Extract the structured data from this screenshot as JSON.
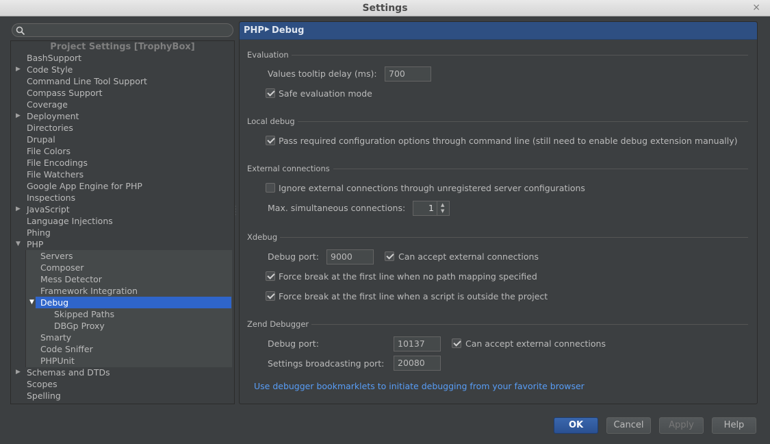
{
  "window": {
    "title": "Settings",
    "close_glyph": "×"
  },
  "search": {
    "placeholder": ""
  },
  "tree": {
    "header": "Project Settings [TrophyBox]",
    "items": [
      {
        "label": "BashSupport",
        "level": 0,
        "expander": ""
      },
      {
        "label": "Code Style",
        "level": 0,
        "expander": "▶"
      },
      {
        "label": "Command Line Tool Support",
        "level": 0,
        "expander": ""
      },
      {
        "label": "Compass Support",
        "level": 0,
        "expander": ""
      },
      {
        "label": "Coverage",
        "level": 0,
        "expander": ""
      },
      {
        "label": "Deployment",
        "level": 0,
        "expander": "▶"
      },
      {
        "label": "Directories",
        "level": 0,
        "expander": ""
      },
      {
        "label": "Drupal",
        "level": 0,
        "expander": ""
      },
      {
        "label": "File Colors",
        "level": 0,
        "expander": ""
      },
      {
        "label": "File Encodings",
        "level": 0,
        "expander": ""
      },
      {
        "label": "File Watchers",
        "level": 0,
        "expander": ""
      },
      {
        "label": "Google App Engine for PHP",
        "level": 0,
        "expander": ""
      },
      {
        "label": "Inspections",
        "level": 0,
        "expander": ""
      },
      {
        "label": "JavaScript",
        "level": 0,
        "expander": "▶"
      },
      {
        "label": "Language Injections",
        "level": 0,
        "expander": ""
      },
      {
        "label": "Phing",
        "level": 0,
        "expander": ""
      },
      {
        "label": "PHP",
        "level": 0,
        "expander": "▼"
      },
      {
        "label": "Servers",
        "level": 1,
        "expander": ""
      },
      {
        "label": "Composer",
        "level": 1,
        "expander": ""
      },
      {
        "label": "Mess Detector",
        "level": 1,
        "expander": ""
      },
      {
        "label": "Framework Integration",
        "level": 1,
        "expander": ""
      },
      {
        "label": "Debug",
        "level": 1,
        "expander": "▼",
        "selected": true
      },
      {
        "label": "Skipped Paths",
        "level": 2,
        "expander": ""
      },
      {
        "label": "DBGp Proxy",
        "level": 2,
        "expander": ""
      },
      {
        "label": "Smarty",
        "level": 1,
        "expander": ""
      },
      {
        "label": "Code Sniffer",
        "level": 1,
        "expander": ""
      },
      {
        "label": "PHPUnit",
        "level": 1,
        "expander": ""
      },
      {
        "label": "Schemas and DTDs",
        "level": 0,
        "expander": "▶"
      },
      {
        "label": "Scopes",
        "level": 0,
        "expander": ""
      },
      {
        "label": "Spelling",
        "level": 0,
        "expander": ""
      }
    ]
  },
  "breadcrumb": {
    "parent": "PHP",
    "separator": "▶",
    "current": "Debug"
  },
  "evaluation": {
    "title": "Evaluation",
    "tooltip_delay_label": "Values tooltip delay (ms):",
    "tooltip_delay_value": "700",
    "safe_mode_label": "Safe evaluation mode",
    "safe_mode_checked": true
  },
  "local_debug": {
    "title": "Local debug",
    "pass_config_label": "Pass required configuration options through command line (still need to enable debug extension manually)",
    "pass_config_checked": true
  },
  "external": {
    "title": "External connections",
    "ignore_label": "Ignore external connections through unregistered server configurations",
    "ignore_checked": false,
    "max_label": "Max. simultaneous connections:",
    "max_value": "1"
  },
  "xdebug": {
    "title": "Xdebug",
    "port_label": "Debug port:",
    "port_value": "9000",
    "accept_label": "Can accept external connections",
    "accept_checked": true,
    "force_no_mapping_label": "Force break at the first line when no path mapping specified",
    "force_no_mapping_checked": true,
    "force_outside_label": "Force break at the first line when a script is outside the project",
    "force_outside_checked": true
  },
  "zend": {
    "title": "Zend Debugger",
    "port_label": "Debug port:",
    "port_value": "10137",
    "accept_label": "Can accept external connections",
    "accept_checked": true,
    "broadcast_label": "Settings broadcasting port:",
    "broadcast_value": "20080"
  },
  "bookmarklets_link": "Use debugger bookmarklets to initiate debugging from your favorite browser",
  "buttons": {
    "ok": "OK",
    "cancel": "Cancel",
    "apply": "Apply",
    "help": "Help"
  }
}
